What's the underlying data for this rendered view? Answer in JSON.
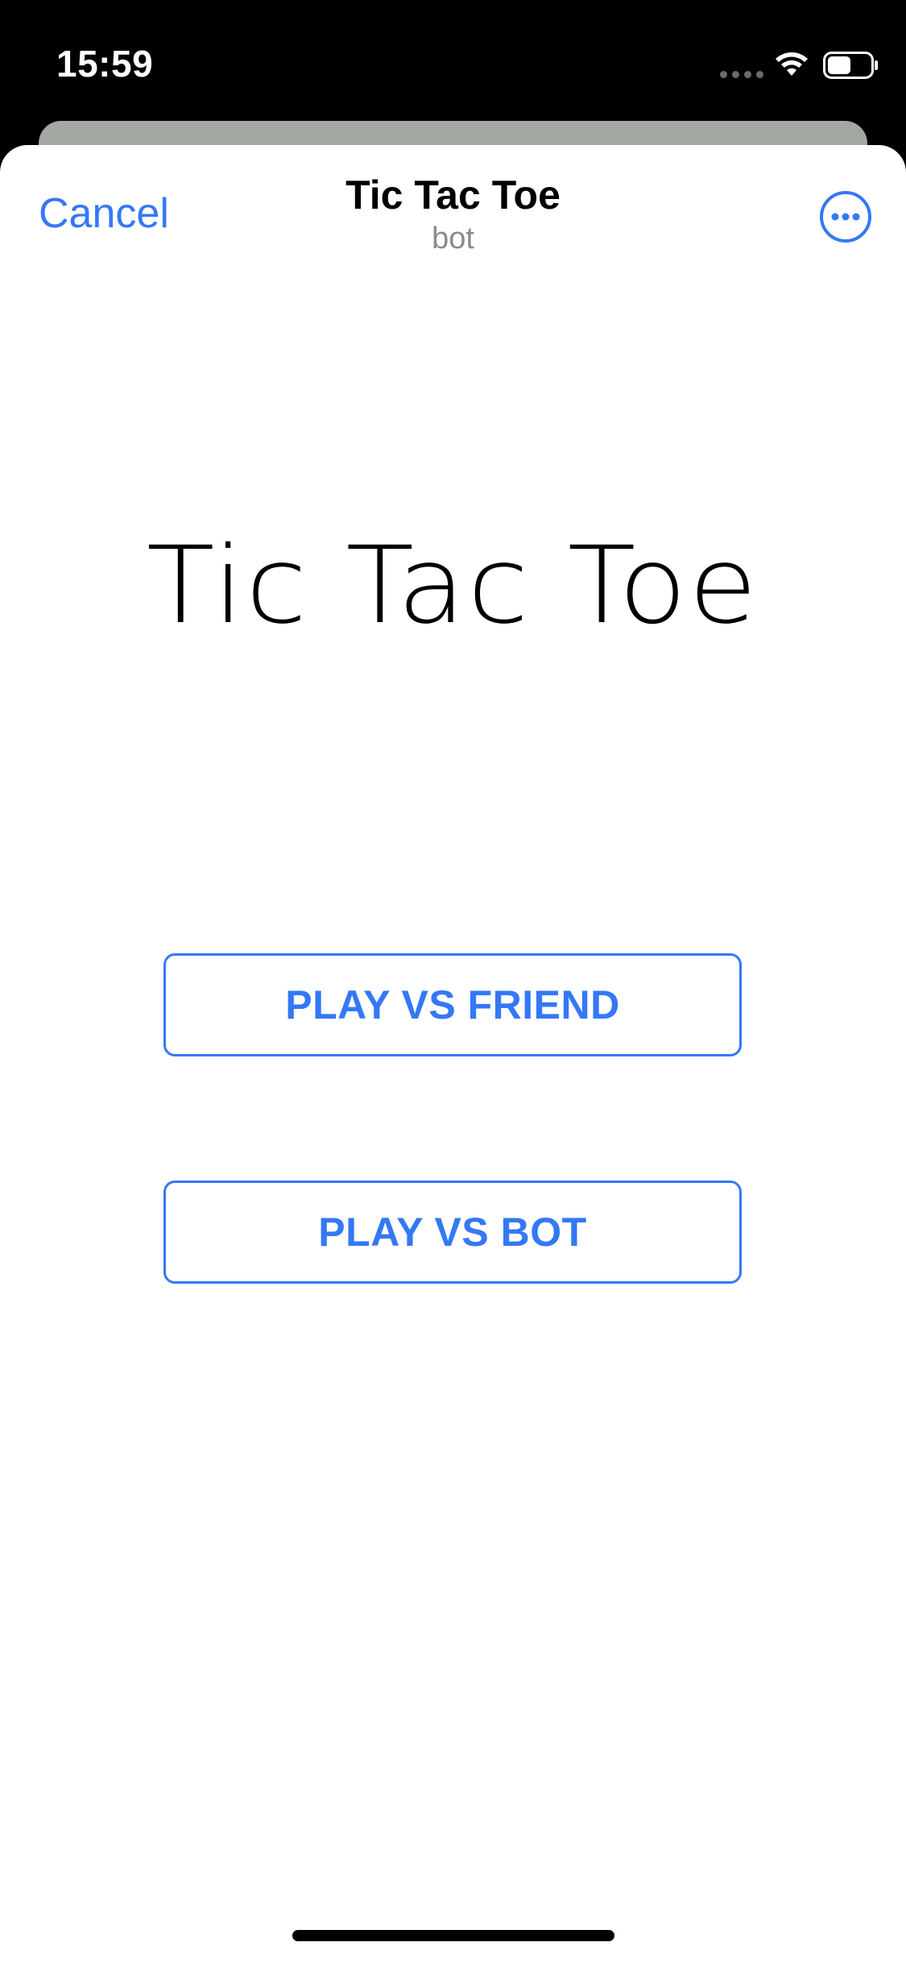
{
  "status_bar": {
    "time": "15:59",
    "icons": [
      "signal-icon",
      "wifi-icon",
      "battery-icon"
    ]
  },
  "nav": {
    "cancel_label": "Cancel",
    "title": "Tic Tac Toe",
    "subtitle": "bot",
    "more_icon": "more-circle-icon"
  },
  "main": {
    "game_title": "Tic Tac Toe",
    "buttons": [
      {
        "label": "PLAY VS FRIEND"
      },
      {
        "label": "PLAY VS BOT"
      }
    ]
  },
  "colors": {
    "accent": "#3478f6",
    "background": "#ffffff",
    "status_bar": "#000000"
  }
}
